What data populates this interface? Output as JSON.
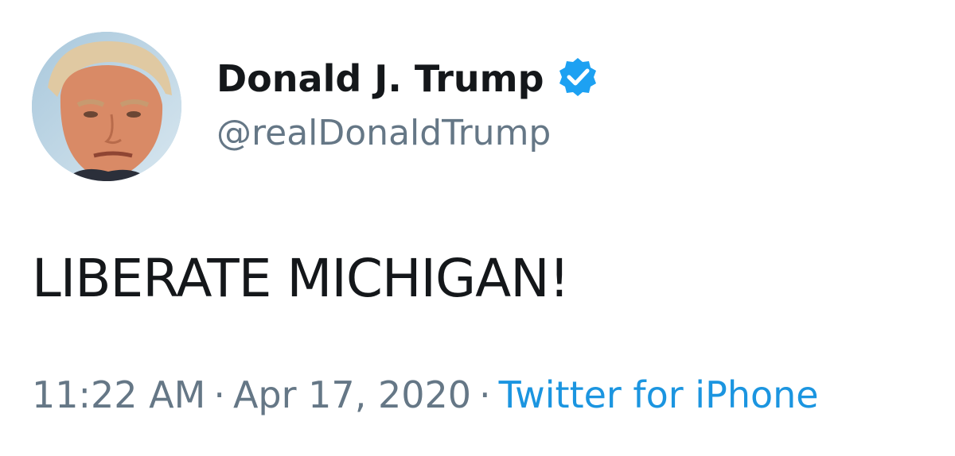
{
  "tweet": {
    "display_name": "Donald J. Trump",
    "handle": "@realDonaldTrump",
    "verified_icon": "verified-badge-icon",
    "verified_color": "#1da1f2",
    "text": "LIBERATE MICHIGAN!",
    "time": "11:22 AM",
    "separator": "·",
    "date": "Apr 17, 2020",
    "source": "Twitter for iPhone",
    "source_color": "#1b95e0",
    "avatar_icon": "profile-avatar"
  }
}
